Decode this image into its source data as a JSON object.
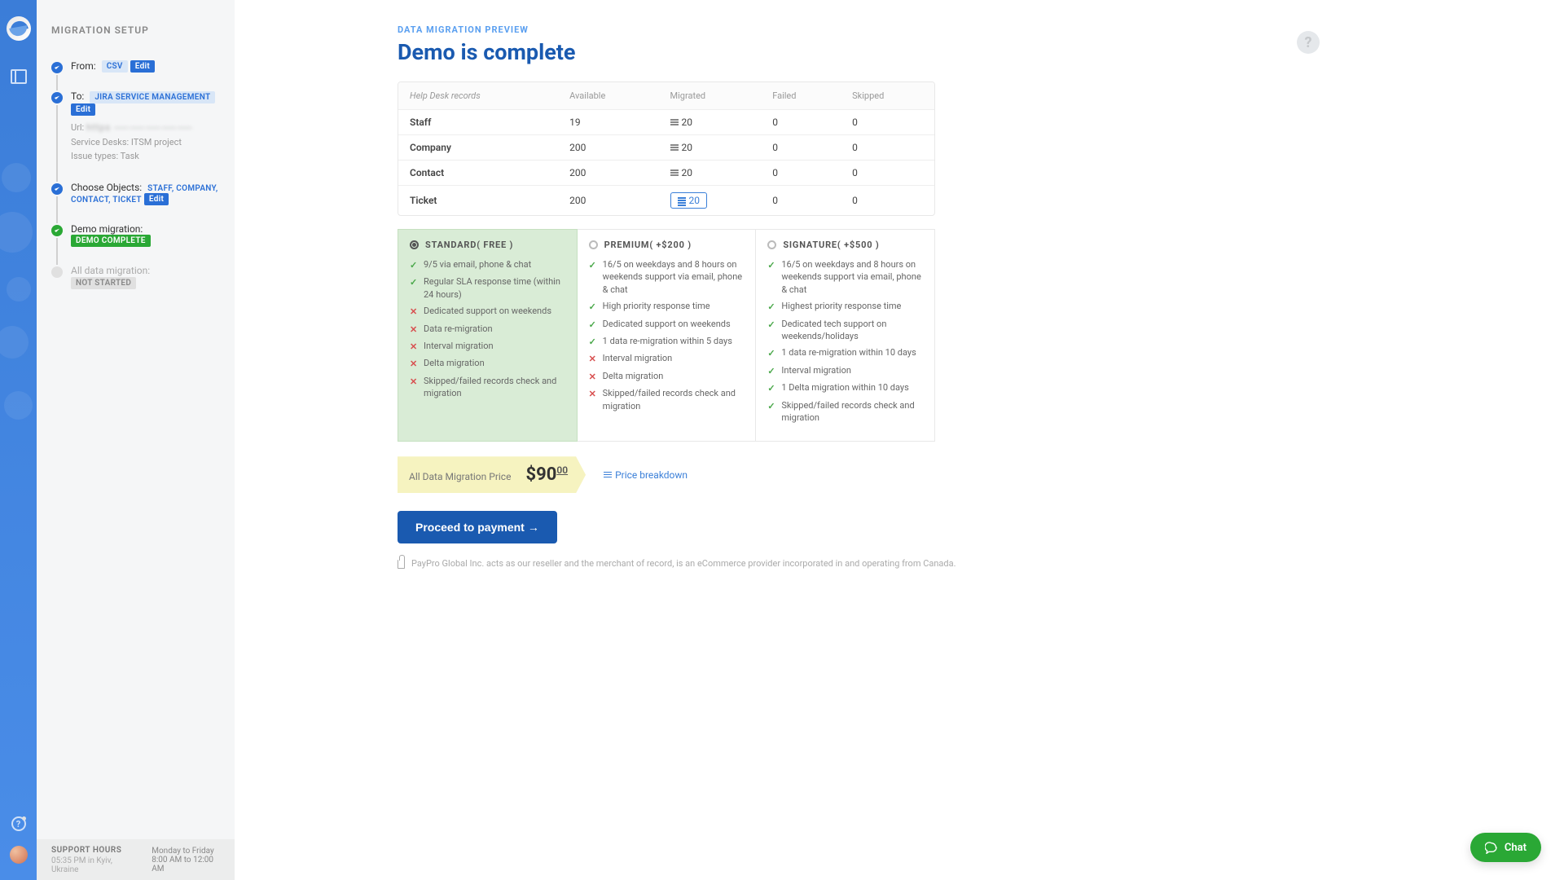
{
  "sidebar": {
    "title": "MIGRATION SETUP",
    "steps": {
      "from": {
        "label": "From:",
        "value": "CSV",
        "edit": "Edit"
      },
      "to": {
        "label": "To:",
        "value": "JIRA SERVICE MANAGEMENT",
        "edit": "Edit",
        "url_label": "Url:",
        "url_value": "https  ⸺⸺⸺⸺⸺",
        "desk_label": "Service Desks:",
        "desk_value": "ITSM project",
        "issue_label": "Issue types:",
        "issue_value": "Task"
      },
      "objects": {
        "label": "Choose Objects:",
        "value": "STAFF, COMPANY, CONTACT, TICKET",
        "edit": "Edit"
      },
      "demo": {
        "label": "Demo migration:",
        "badge": "DEMO COMPLETE"
      },
      "all": {
        "label": "All data migration:",
        "badge": "NOT STARTED"
      }
    },
    "support": {
      "heading": "SUPPORT HOURS",
      "local": "05:35 PM in Kyiv, Ukraine",
      "days": "Monday to Friday",
      "hours": "8:00 AM to 12:00 AM"
    }
  },
  "main": {
    "eyebrow": "DATA MIGRATION PREVIEW",
    "title": "Demo is complete",
    "help": "?",
    "records": {
      "headers": {
        "c0": "Help Desk records",
        "c1": "Available",
        "c2": "Migrated",
        "c3": "Failed",
        "c4": "Skipped"
      },
      "rows": [
        {
          "name": "Staff",
          "avail": "19",
          "migr": "20",
          "failed": "0",
          "skipped": "0",
          "link": false
        },
        {
          "name": "Company",
          "avail": "200",
          "migr": "20",
          "failed": "0",
          "skipped": "0",
          "link": false
        },
        {
          "name": "Contact",
          "avail": "200",
          "migr": "20",
          "failed": "0",
          "skipped": "0",
          "link": false
        },
        {
          "name": "Ticket",
          "avail": "200",
          "migr": "20",
          "failed": "0",
          "skipped": "0",
          "link": true
        }
      ]
    },
    "plans": [
      {
        "name": "STANDARD( FREE )",
        "selected": true,
        "features": [
          {
            "ok": true,
            "text": "9/5 via email, phone & chat"
          },
          {
            "ok": true,
            "text": "Regular SLA response time (within 24 hours)"
          },
          {
            "ok": false,
            "text": "Dedicated support on weekends"
          },
          {
            "ok": false,
            "text": "Data re-migration"
          },
          {
            "ok": false,
            "text": "Interval migration"
          },
          {
            "ok": false,
            "text": "Delta migration"
          },
          {
            "ok": false,
            "text": "Skipped/failed records check and migration"
          }
        ]
      },
      {
        "name": "PREMIUM( +$200 )",
        "selected": false,
        "features": [
          {
            "ok": true,
            "text": "16/5 on weekdays and 8 hours on weekends support via email, phone & chat"
          },
          {
            "ok": true,
            "text": "High priority response time"
          },
          {
            "ok": true,
            "text": "Dedicated support on weekends"
          },
          {
            "ok": true,
            "text": "1 data re-migration within 5 days"
          },
          {
            "ok": false,
            "text": "Interval migration"
          },
          {
            "ok": false,
            "text": "Delta migration"
          },
          {
            "ok": false,
            "text": "Skipped/failed records check and migration"
          }
        ]
      },
      {
        "name": "SIGNATURE( +$500 )",
        "selected": false,
        "features": [
          {
            "ok": true,
            "text": "16/5 on weekdays and 8 hours on weekends support via email, phone & chat"
          },
          {
            "ok": true,
            "text": "Highest priority response time"
          },
          {
            "ok": true,
            "text": "Dedicated tech support on weekends/holidays"
          },
          {
            "ok": true,
            "text": "1 data re-migration within 10 days"
          },
          {
            "ok": true,
            "text": "Interval migration"
          },
          {
            "ok": true,
            "text": "1 Delta migration within 10 days"
          },
          {
            "ok": true,
            "text": "Skipped/failed records check and migration"
          }
        ]
      }
    ],
    "price": {
      "label": "All Data Migration Price",
      "whole": "$90",
      "cents": "00",
      "breakdown": "Price breakdown"
    },
    "cta": "Proceed to payment",
    "disclaimer": "PayPro Global Inc. acts as our reseller and the merchant of record, is an eCommerce provider incorporated in and operating from Canada."
  },
  "chat": {
    "label": "Chat"
  }
}
